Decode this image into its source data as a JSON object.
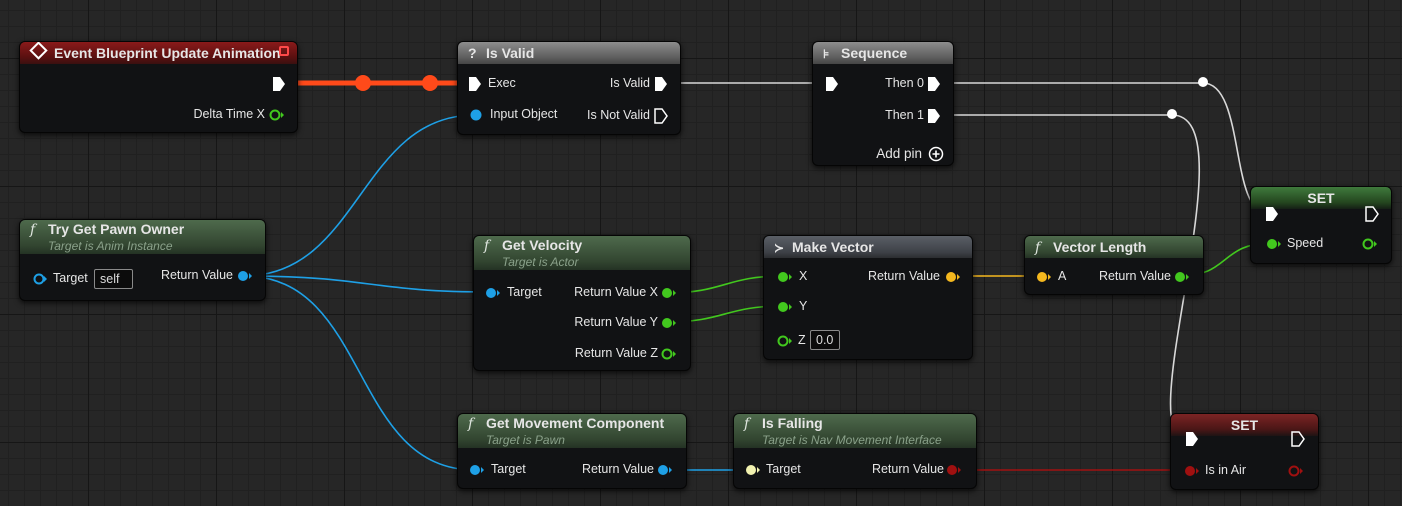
{
  "nodes": {
    "event": {
      "title": "Event Blueprint Update Animation",
      "delta_label": "Delta Time X"
    },
    "is_valid": {
      "title": "Is Valid",
      "exec_label": "Exec",
      "input_label": "Input Object",
      "valid_label": "Is Valid",
      "not_valid_label": "Is Not Valid"
    },
    "sequence": {
      "title": "Sequence",
      "then0_label": "Then 0",
      "then1_label": "Then 1",
      "add_pin_label": "Add pin"
    },
    "try_get_pawn": {
      "title": "Try Get Pawn Owner",
      "subtitle": "Target is Anim Instance",
      "target_label": "Target",
      "target_value": "self",
      "return_label": "Return Value"
    },
    "get_velocity": {
      "title": "Get Velocity",
      "subtitle": "Target is Actor",
      "target_label": "Target",
      "rx_label": "Return Value X",
      "ry_label": "Return Value Y",
      "rz_label": "Return Value Z"
    },
    "make_vector": {
      "title": "Make Vector",
      "x_label": "X",
      "y_label": "Y",
      "z_label": "Z",
      "z_value": "0.0",
      "return_label": "Return Value"
    },
    "vector_length": {
      "title": "Vector Length",
      "a_label": "A",
      "return_label": "Return Value"
    },
    "set_speed": {
      "title": "SET",
      "speed_label": "Speed"
    },
    "get_movement": {
      "title": "Get Movement Component",
      "subtitle": "Target is Pawn",
      "target_label": "Target",
      "return_label": "Return Value"
    },
    "is_falling": {
      "title": "Is Falling",
      "subtitle": "Target is Nav Movement Interface",
      "target_label": "Target",
      "return_label": "Return Value"
    },
    "set_air": {
      "title": "SET",
      "air_label": "Is in Air"
    }
  },
  "colors": {
    "exec": "#ffffff",
    "exec_active": "#ff4a1a",
    "object": "#1ea0e6",
    "float": "#42c81e",
    "vector": "#f5b81e",
    "bool": "#a01010",
    "interface": "#f2f2b0"
  }
}
